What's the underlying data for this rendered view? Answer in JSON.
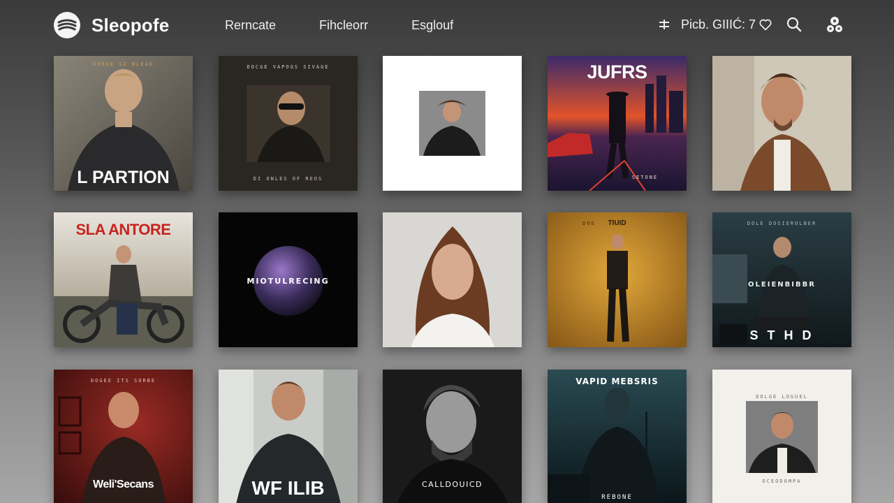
{
  "app": {
    "name": "Sleopofe"
  },
  "nav": {
    "items": [
      "Rerncate",
      "Fihcleorr",
      "Esglouf"
    ]
  },
  "toolbar": {
    "status": "Picb. GIIIĆ: 7",
    "icons": [
      "filter-icon",
      "heart-icon",
      "search-icon",
      "profile-icon"
    ]
  },
  "albums": [
    {
      "title": "L PARTION",
      "top_text": "DORGE SI BLEAD"
    },
    {
      "top_text": "DOCGE VAPOGS SIVAGE",
      "bottom_text": "DI ONLES OF REOS"
    },
    {},
    {
      "title": "JUFRS",
      "bottom_text": "SETONE"
    },
    {},
    {
      "title": "SLA ANTORE"
    },
    {
      "title": "MIOTULRECING"
    },
    {},
    {
      "title": "TIUID",
      "top_text": "DOE"
    },
    {
      "title": "OLEIENBIBBR",
      "top_text": "DOLE DOSIEROLBER",
      "bottom_text": "S T H D"
    },
    {
      "title": "Weli'Secans",
      "top_text": "DOGEE ITS SORBE"
    },
    {
      "title": "WF ILIB"
    },
    {
      "title": "CALLDOUICD"
    },
    {
      "title": "VAPID MEBSRIS",
      "bottom_text": "REBONE"
    },
    {
      "top_text": "DOLGE LOGUEL",
      "bottom_text": "OCEODOMPA"
    }
  ],
  "colors": {
    "background": "#5c5c5c",
    "text": "#f2f2f2",
    "accent_red": "#c8241e"
  }
}
